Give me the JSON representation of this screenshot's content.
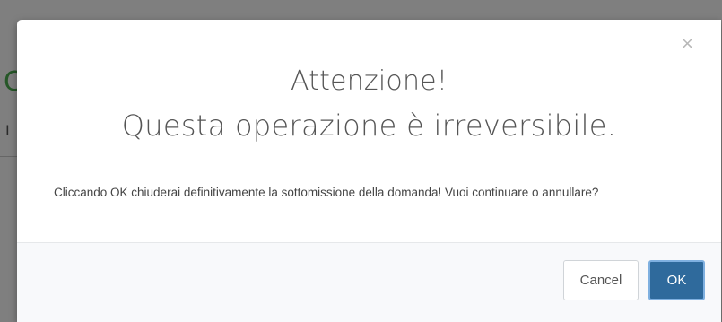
{
  "modal": {
    "close_glyph": "×",
    "title_line1": "Attenzione!",
    "title_line2": "Questa operazione è irreversibile.",
    "body_text": "Cliccando OK chiuderai definitivamente la sottomissione della domanda! Vuoi continuare o annullare?",
    "buttons": {
      "cancel_label": "Cancel",
      "ok_label": "OK"
    }
  },
  "background": {
    "fragment_c": "C",
    "fragment_i": "I"
  },
  "colors": {
    "overlay": "#000000",
    "ok_button": "#2f6a9c",
    "ok_button_border": "#7fb0e0",
    "footer_background": "#f8f9fb",
    "background_heading": "#4caf50"
  },
  "icons": {
    "close": "close-icon"
  }
}
